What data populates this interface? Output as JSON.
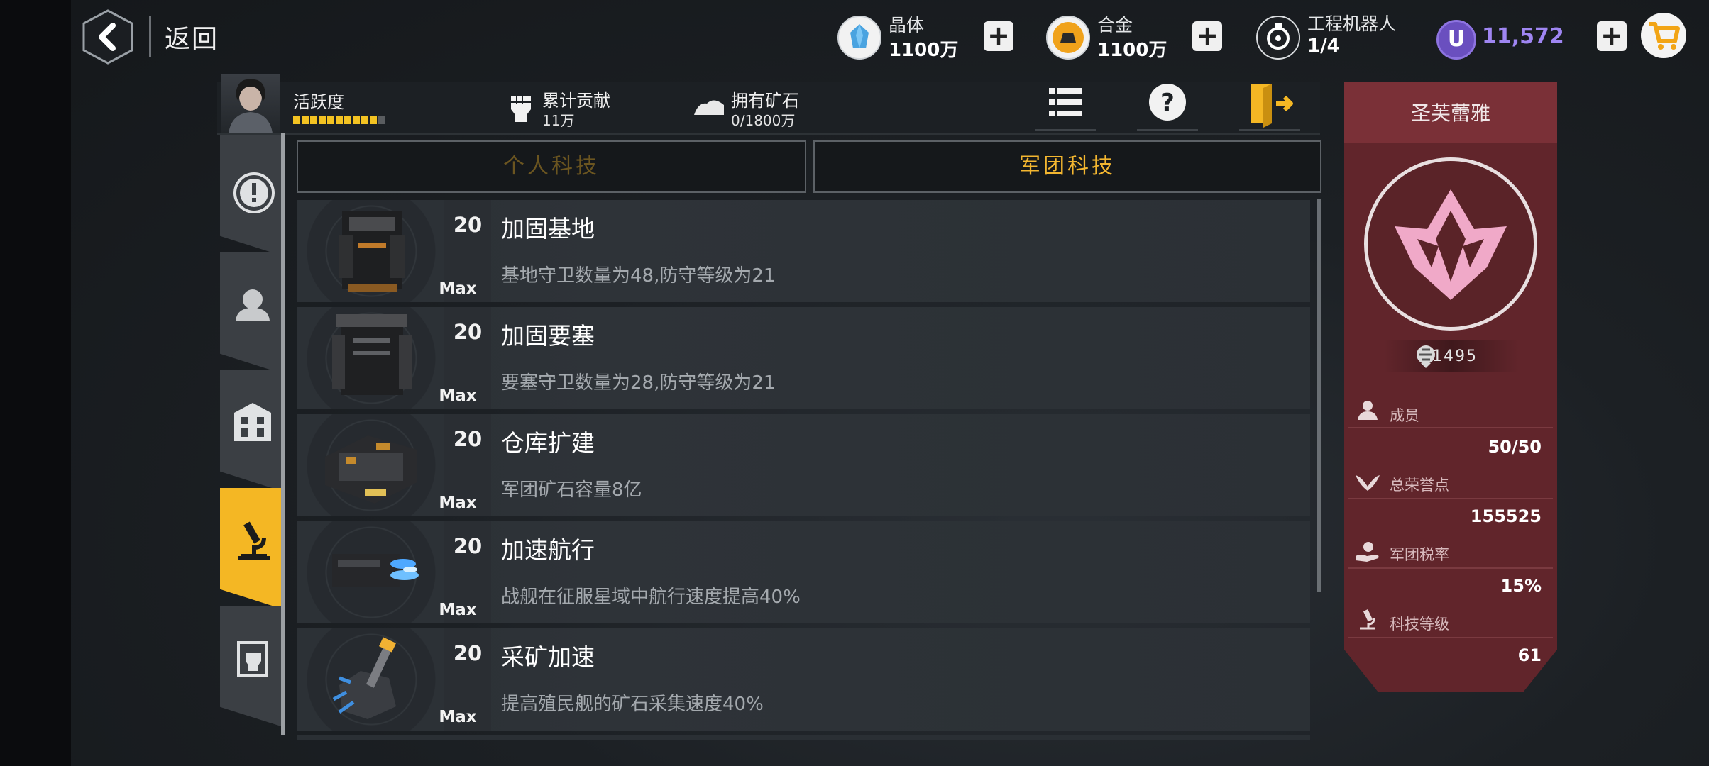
{
  "header": {
    "back_label": "返回",
    "resources": [
      {
        "name": "晶体",
        "value": "1100万",
        "icon": "crystal-icon"
      },
      {
        "name": "合金",
        "value": "1100万",
        "icon": "alloy-icon"
      },
      {
        "name": "工程机器人",
        "value": "1/4",
        "icon": "robot-icon"
      }
    ],
    "premium": {
      "symbol": "U",
      "value": "11,572"
    }
  },
  "infobar": {
    "activity_label": "活跃度",
    "activity_segments_filled": 10,
    "activity_segments_total": 11,
    "contribution_label": "累计贡献",
    "contribution_value": "11万",
    "ore_label": "拥有矿石",
    "ore_value": "0/1800万"
  },
  "tabs": {
    "personal": "个人科技",
    "legion": "军团科技"
  },
  "tech_list": [
    {
      "level": "20",
      "max": "Max",
      "title": "加固基地",
      "desc": "基地守卫数量为48,防守等级为21"
    },
    {
      "level": "20",
      "max": "Max",
      "title": "加固要塞",
      "desc": "要塞守卫数量为28,防守等级为21"
    },
    {
      "level": "20",
      "max": "Max",
      "title": "仓库扩建",
      "desc": "军团矿石容量8亿"
    },
    {
      "level": "20",
      "max": "Max",
      "title": "加速航行",
      "desc": "战舰在征服星域中航行速度提高40%"
    },
    {
      "level": "20",
      "max": "Max",
      "title": "采矿加速",
      "desc": "提高殖民舰的矿石采集速度40%"
    }
  ],
  "guild": {
    "name": "圣芙蕾雅",
    "power": "1495",
    "stats": [
      {
        "label": "成员",
        "value": "50/50"
      },
      {
        "label": "总荣誉点",
        "value": "155525"
      },
      {
        "label": "军团税率",
        "value": "15%"
      },
      {
        "label": "科技等级",
        "value": "61"
      }
    ]
  },
  "colors": {
    "accent": "#f4b724",
    "panel": "#61252b",
    "premium": "#9f86f2"
  }
}
